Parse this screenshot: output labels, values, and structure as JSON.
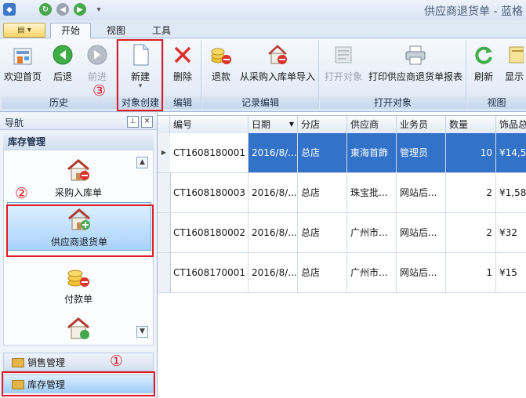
{
  "window": {
    "title": "供应商退货单 - 蓝格"
  },
  "quick_access": [
    "app-menu-icon",
    "refresh-icon",
    "back-icon",
    "forward-icon",
    "dropdown-icon"
  ],
  "tabs": [
    {
      "label": "开始",
      "active": true
    },
    {
      "label": "视图",
      "active": false
    },
    {
      "label": "工具",
      "active": false
    }
  ],
  "ribbon": {
    "groups": {
      "history": "历史",
      "create": "对象创建",
      "edit": "编辑",
      "record_edit": "记录编辑",
      "open": "打开对象",
      "view": "视图"
    },
    "buttons": {
      "home": "欢迎首页",
      "back": "后退",
      "forward": "前进",
      "new": "新建",
      "delete": "删除",
      "refund": "退款",
      "import": "从采购入库单导入",
      "open_obj": "打开对象",
      "print": "打印供应商退货单报表",
      "refresh": "刷新",
      "show": "显示"
    }
  },
  "annotations": {
    "one": "①",
    "two": "②",
    "three": "③"
  },
  "nav": {
    "title": "导航",
    "section": "库存管理",
    "items": [
      "采购入库单",
      "供应商退货单",
      "付款单"
    ],
    "selected_index": 1,
    "panes": [
      "销售管理",
      "库存管理"
    ]
  },
  "grid": {
    "columns": [
      "编号",
      "日期",
      "分店",
      "供应商",
      "业务员",
      "数量",
      "饰品总"
    ],
    "rows": [
      {
        "id": "CT1608180001",
        "date": "2016/8/...",
        "branch": "总店",
        "supplier": "東海首飾",
        "staff": "管理员",
        "qty": "10",
        "total": "¥14,5"
      },
      {
        "id": "CT1608180003",
        "date": "2016/8/...",
        "branch": "总店",
        "supplier": "珠宝批...",
        "staff": "网站后...",
        "qty": "2",
        "total": "¥1,58"
      },
      {
        "id": "CT1608180002",
        "date": "2016/8/...",
        "branch": "总店",
        "supplier": "广州市...",
        "staff": "网站后...",
        "qty": "2",
        "total": "¥32"
      },
      {
        "id": "CT1608170001",
        "date": "2016/8/...",
        "branch": "总店",
        "supplier": "广州市...",
        "staff": "网站后...",
        "qty": "1",
        "total": "¥15"
      }
    ],
    "selected_row": 0
  },
  "colors": {
    "selection": "#3272c8",
    "highlight_box": "#e01c24",
    "accent": "#4ea3f0"
  }
}
